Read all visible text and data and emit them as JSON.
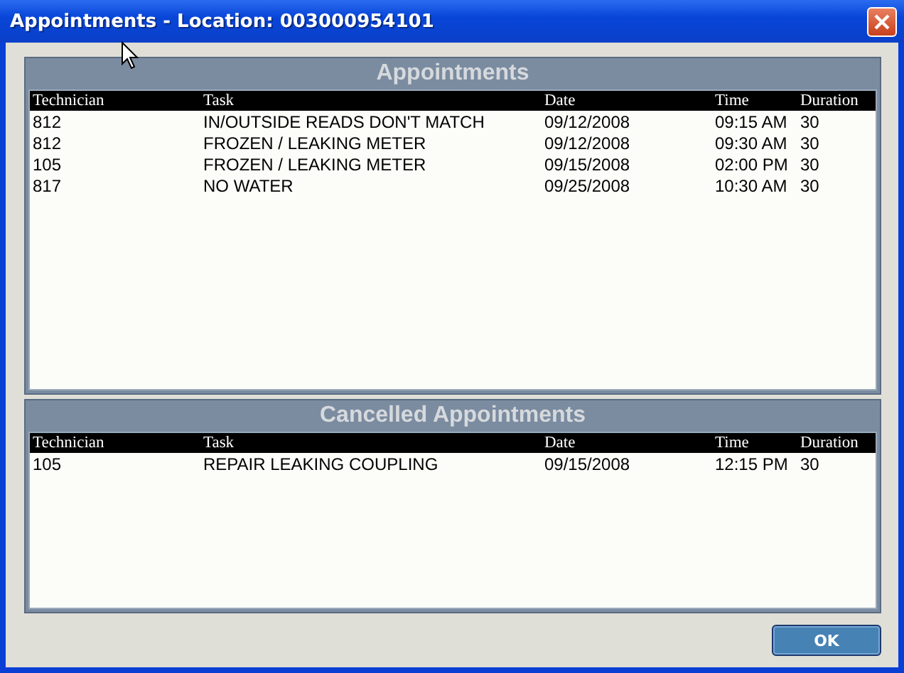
{
  "window": {
    "title": "Appointments - Location: 003000954101"
  },
  "sections": [
    {
      "title": "Appointments",
      "columns": [
        "Technician",
        "Task",
        "Date",
        "Time",
        "Duration"
      ],
      "rows": [
        [
          "812",
          "IN/OUTSIDE READS DON'T MATCH",
          "09/12/2008",
          "09:15 AM",
          "30"
        ],
        [
          "812",
          "FROZEN / LEAKING METER",
          "09/12/2008",
          "09:30 AM",
          "30"
        ],
        [
          "105",
          "FROZEN / LEAKING METER",
          "09/15/2008",
          "02:00 PM",
          "30"
        ],
        [
          "817",
          "NO WATER",
          "09/25/2008",
          "10:30 AM",
          "30"
        ]
      ]
    },
    {
      "title": "Cancelled Appointments",
      "columns": [
        "Technician",
        "Task",
        "Date",
        "Time",
        "Duration"
      ],
      "rows": [
        [
          "105",
          "REPAIR LEAKING COUPLING",
          "09/15/2008",
          "12:15 PM",
          "30"
        ]
      ]
    }
  ],
  "buttons": [
    "OK"
  ]
}
